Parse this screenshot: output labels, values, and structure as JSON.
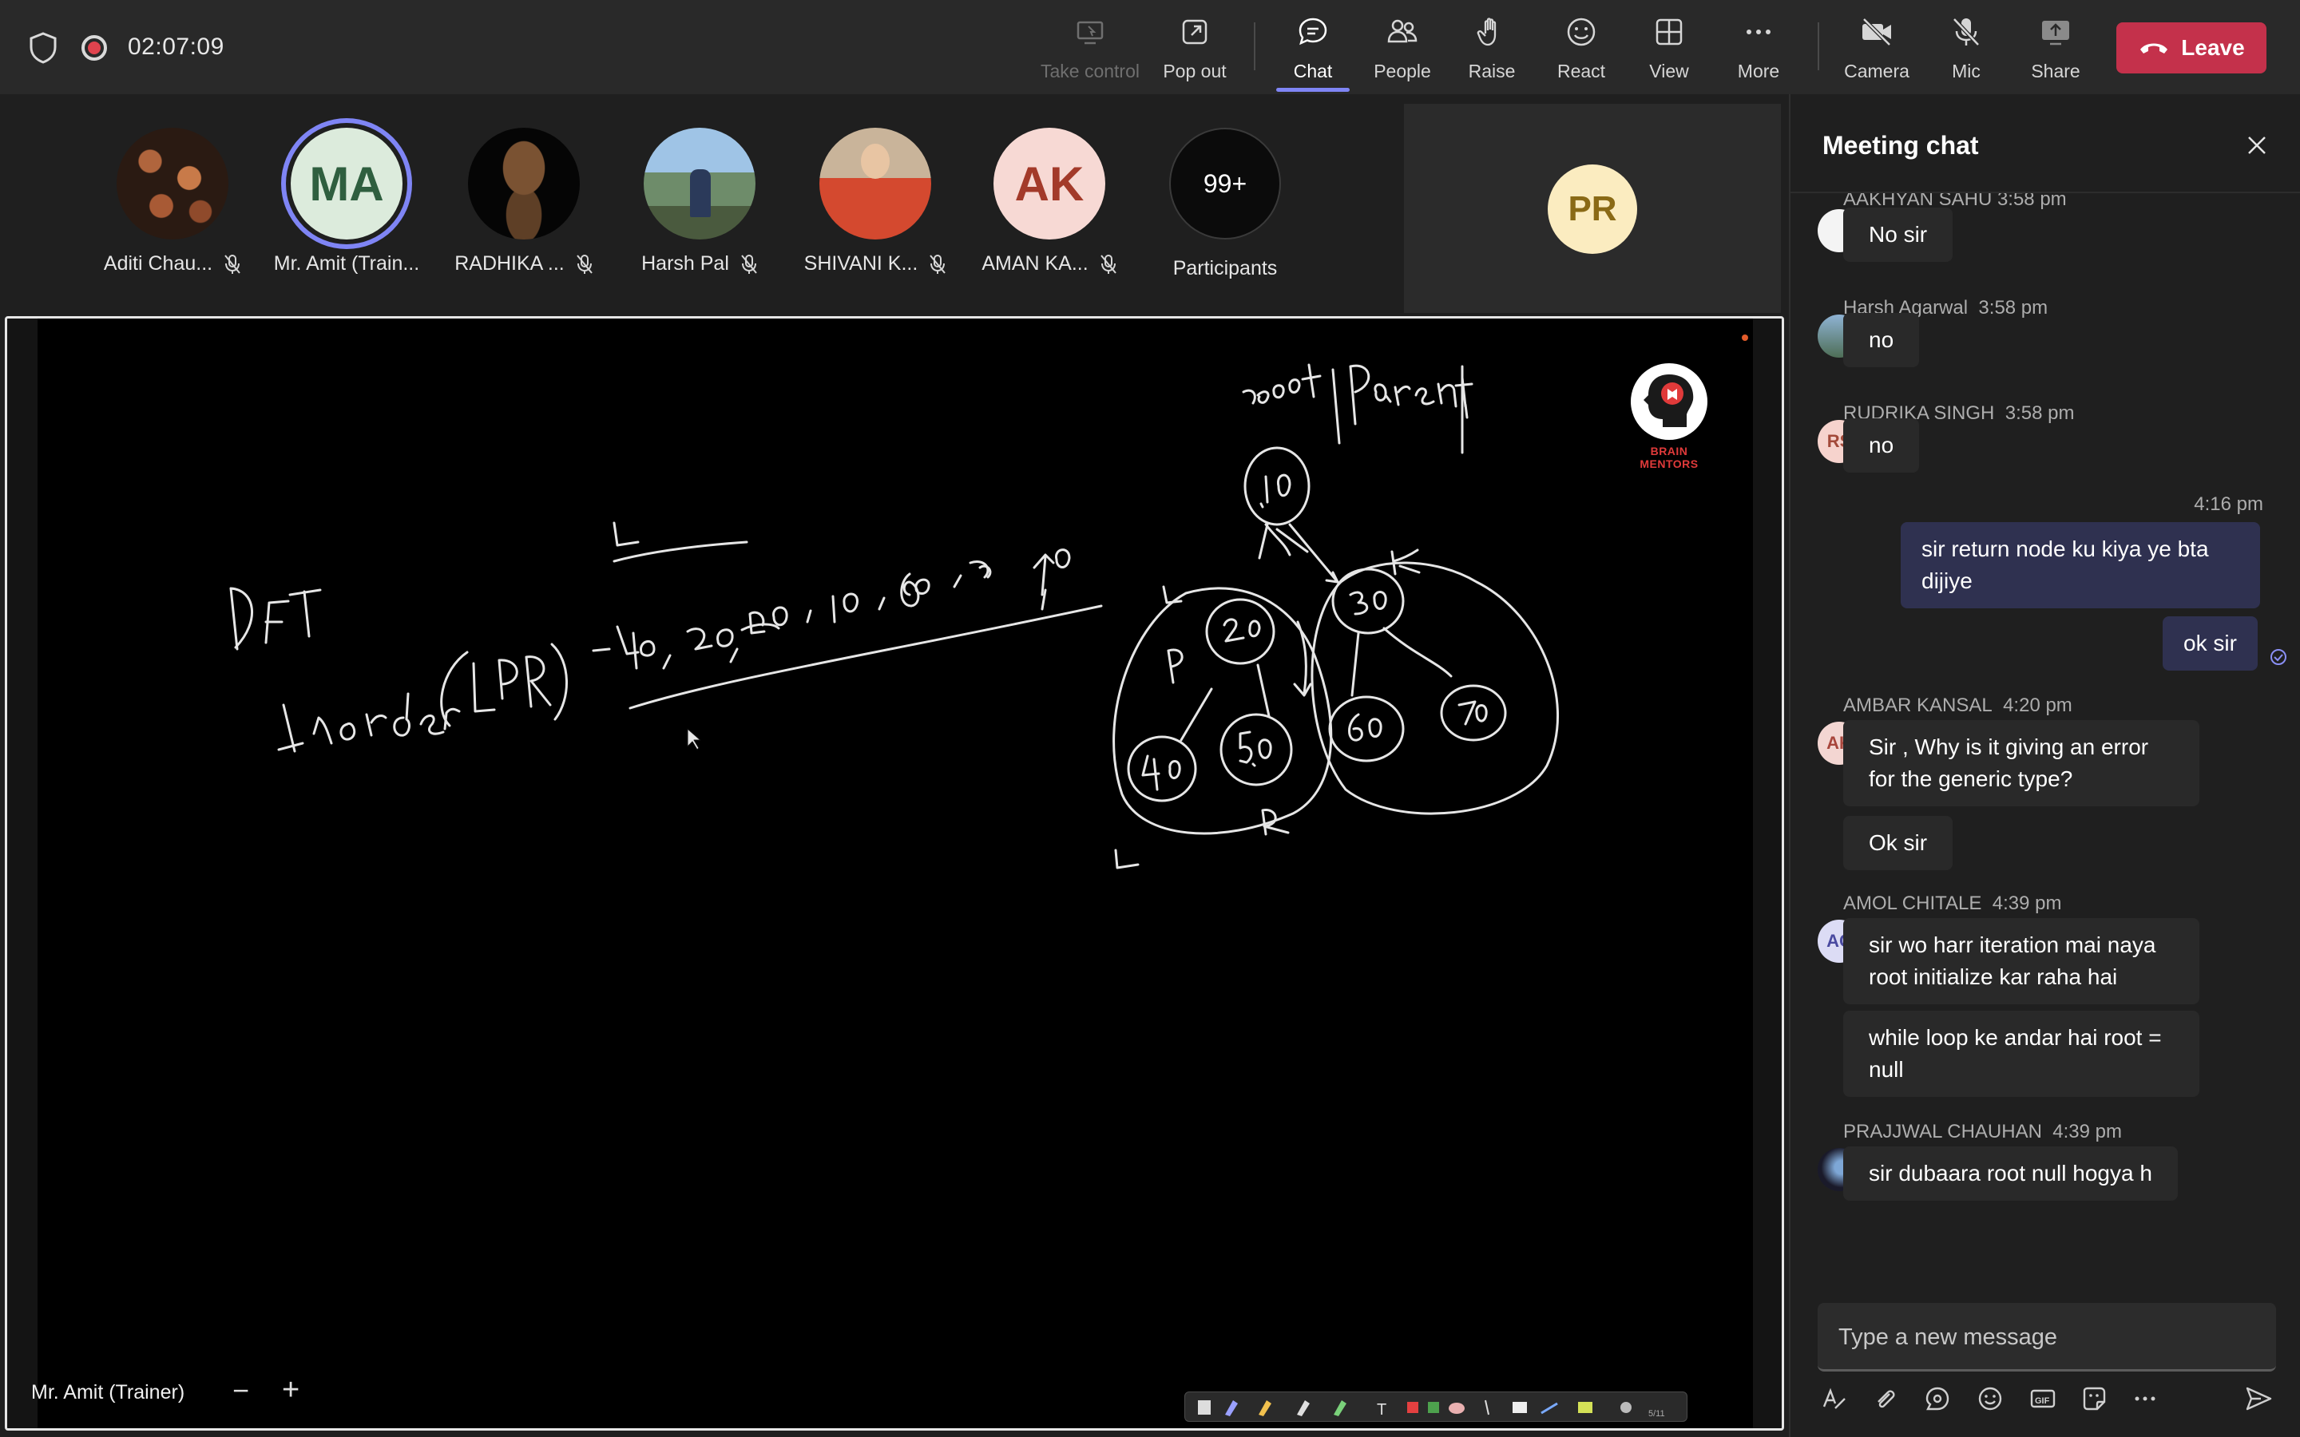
{
  "topbar": {
    "timer": "02:07:09",
    "buttons": {
      "take_control": "Take control",
      "pop_out": "Pop out",
      "chat": "Chat",
      "people": "People",
      "raise": "Raise",
      "react": "React",
      "view": "View",
      "more": "More",
      "camera": "Camera",
      "mic": "Mic",
      "share": "Share"
    },
    "leave": "Leave",
    "active_tab": "Chat"
  },
  "participants": [
    {
      "name": "Aditi Chau...",
      "muted": true
    },
    {
      "name": "Mr. Amit (Train...",
      "initials": "MA",
      "speaking": true
    },
    {
      "name": "RADHIKA ...",
      "muted": true
    },
    {
      "name": "Harsh Pal",
      "muted": true
    },
    {
      "name": "SHIVANI K...",
      "muted": true
    },
    {
      "name": "AMAN KA...",
      "initials": "AK",
      "muted": true
    }
  ],
  "participants_more": {
    "count": "99+",
    "label": "Participants"
  },
  "pr_tile": {
    "initials": "PR"
  },
  "stage": {
    "presenter": "Mr. Amit (Trainer)",
    "zoom_minus": "−",
    "zoom_plus": "+",
    "logo_text": "BRAIN MENTORS",
    "whiteboard": {
      "heading": "DFT",
      "line2": "Inorder (LPR) - 40, 20, 50, 10, 60, 30, 70",
      "tree_label": "root / Parent / P",
      "nodes": [
        "10",
        "20",
        "30",
        "40",
        "50",
        "60",
        "70"
      ]
    }
  },
  "chat": {
    "title": "Meeting chat",
    "truncated_meta": "AAKHYAN SAHU  3:58 pm",
    "messages": [
      {
        "sender": "",
        "time": "",
        "initials": "",
        "text": "No sir"
      },
      {
        "sender": "Harsh Agarwal",
        "time": "3:58 pm",
        "text": "no"
      },
      {
        "sender": "RUDRIKA SINGH",
        "time": "3:58 pm",
        "initials": "RS",
        "text": "no"
      },
      {
        "mine": true,
        "time": "4:16 pm",
        "text": "sir return node ku kiya ye bta dijiye"
      },
      {
        "mine": true,
        "text": "ok sir"
      },
      {
        "sender": "AMBAR KANSAL",
        "time": "4:20 pm",
        "initials": "AK",
        "text": "Sir , Why is it giving an error for the generic type?"
      },
      {
        "text": "Ok sir"
      },
      {
        "sender": "AMOL CHITALE",
        "time": "4:39 pm",
        "initials": "AC",
        "text": "sir wo harr iteration mai naya root initialize kar raha hai"
      },
      {
        "text": "while loop ke andar hai root = null"
      },
      {
        "sender": "PRAJJWAL CHAUHAN",
        "time": "4:39 pm",
        "text": "sir dubaara root null hogya h"
      }
    ],
    "composer_placeholder": "Type a new message"
  },
  "colors": {
    "accent": "#7f85f5",
    "leave": "#c4314b",
    "bubble_mine": "#2f3150",
    "bubble_other": "#292929"
  }
}
